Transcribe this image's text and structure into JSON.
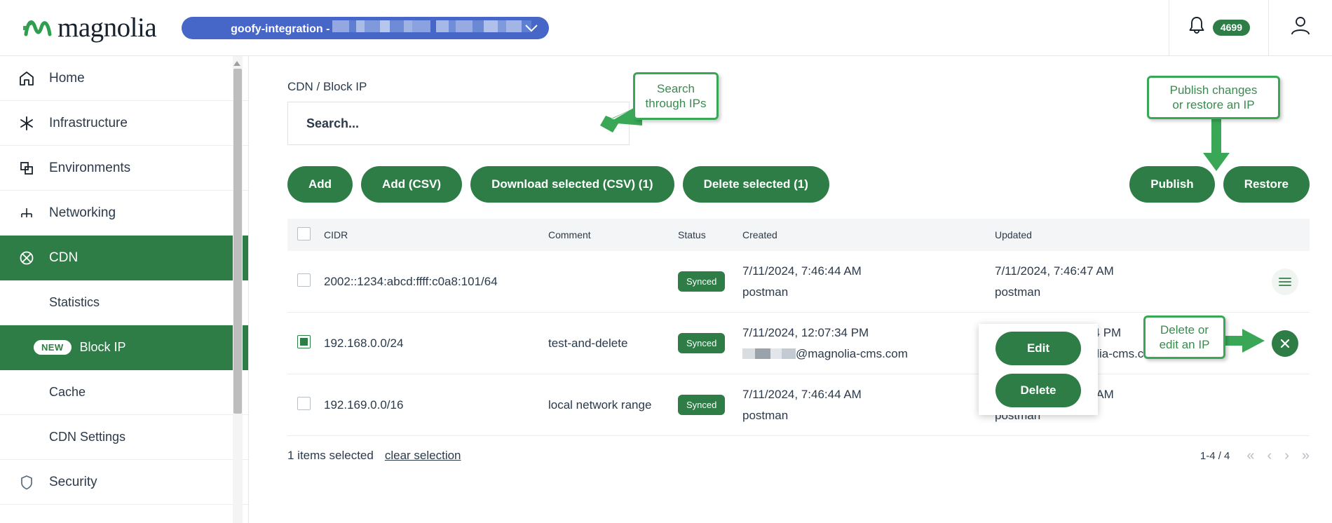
{
  "header": {
    "logo_text": "magnolia",
    "logo_icon": "magnolia-wave-logo-icon",
    "environment": {
      "prefix": "goofy-integration -",
      "redacted": true,
      "caret_icon": "chevron-down-icon"
    },
    "notifications": {
      "icon": "bell-icon",
      "count": "4699"
    },
    "profile_icon": "user-account-icon"
  },
  "sidebar": {
    "items": [
      {
        "label": "Home",
        "icon": "home-icon",
        "active": false,
        "type": "top"
      },
      {
        "label": "Infrastructure",
        "icon": "asterisk-icon",
        "active": false,
        "type": "top"
      },
      {
        "label": "Environments",
        "icon": "stacked-squares-icon",
        "active": false,
        "type": "top"
      },
      {
        "label": "Networking",
        "icon": "network-node-icon",
        "active": false,
        "type": "top"
      },
      {
        "label": "CDN",
        "icon": "cdn-circle-x-icon",
        "active": true,
        "type": "top"
      },
      {
        "label": "Statistics",
        "icon": "",
        "active": false,
        "type": "sub"
      },
      {
        "label": "Block IP",
        "icon": "",
        "active": true,
        "type": "sub",
        "chip": "NEW"
      },
      {
        "label": "Cache",
        "icon": "",
        "active": false,
        "type": "sub"
      },
      {
        "label": "CDN Settings",
        "icon": "",
        "active": false,
        "type": "sub"
      },
      {
        "label": "Security",
        "icon": "shield-icon",
        "active": false,
        "type": "top"
      }
    ],
    "scrollbar": {
      "up_arrow_icon": "scroll-up-arrow-icon"
    }
  },
  "main": {
    "breadcrumb": "CDN / Block IP",
    "search": {
      "placeholder": "Search...",
      "value": ""
    },
    "buttons_left": [
      {
        "label": "Add",
        "name": "add-button"
      },
      {
        "label": "Add (CSV)",
        "name": "add-csv-button"
      },
      {
        "label": "Download selected (CSV) (1)",
        "name": "download-selected-csv-button"
      },
      {
        "label": "Delete selected (1)",
        "name": "delete-selected-button"
      }
    ],
    "buttons_right": [
      {
        "label": "Publish",
        "name": "publish-button"
      },
      {
        "label": "Restore",
        "name": "restore-button"
      }
    ],
    "table": {
      "columns": [
        "CIDR",
        "Comment",
        "Status",
        "Created",
        "Updated"
      ],
      "rows": [
        {
          "selected": false,
          "cidr": "2002::1234:abcd:ffff:c0a8:101/64",
          "comment": "",
          "status": "Synced",
          "created_date": "7/11/2024, 7:46:44 AM",
          "created_by": "postman",
          "created_by_redacted": false,
          "updated_date": "7/11/2024, 7:46:47 AM",
          "updated_by": "postman",
          "updated_by_redacted": false,
          "action_icon": "hamburger-menu-icon"
        },
        {
          "selected": true,
          "cidr": "192.168.0.0/24",
          "comment": "test-and-delete",
          "status": "Synced",
          "created_date": "7/11/2024, 12:07:34 PM",
          "created_by": "@magnolia-cms.com",
          "created_by_redacted": true,
          "updated_date": "7/11/2024, 12:07:34 PM",
          "updated_by": "@magnolia-cms.com",
          "updated_by_redacted": true,
          "action_icon": "close-x-icon"
        },
        {
          "selected": false,
          "cidr": "192.169.0.0/16",
          "comment": "local network range",
          "status": "Synced",
          "created_date": "7/11/2024, 7:46:44 AM",
          "created_by": "postman",
          "created_by_redacted": false,
          "updated_date": "7/11/2024, 7:46:44 AM",
          "updated_by": "postman",
          "updated_by_redacted": false,
          "action_icon": ""
        }
      ]
    },
    "row_popup": {
      "edit_label": "Edit",
      "delete_label": "Delete"
    },
    "footer": {
      "selection_text": "1 items selected",
      "clear_selection": "clear selection",
      "page_range": "1-4 / 4",
      "first_icon": "«",
      "prev_icon": "‹",
      "next_icon": "›",
      "last_icon": "»"
    }
  },
  "annotations": [
    {
      "name": "search-callout",
      "text": "Search\nthrough IPs"
    },
    {
      "name": "publish-callout",
      "text": "Publish changes\nor restore an IP"
    },
    {
      "name": "row-action-callout",
      "text": "Delete or\nedit an IP"
    }
  ],
  "colors": {
    "brand_green": "#2e7d46",
    "annotation_green": "#3aa757",
    "env_blue": "#4666c8"
  }
}
